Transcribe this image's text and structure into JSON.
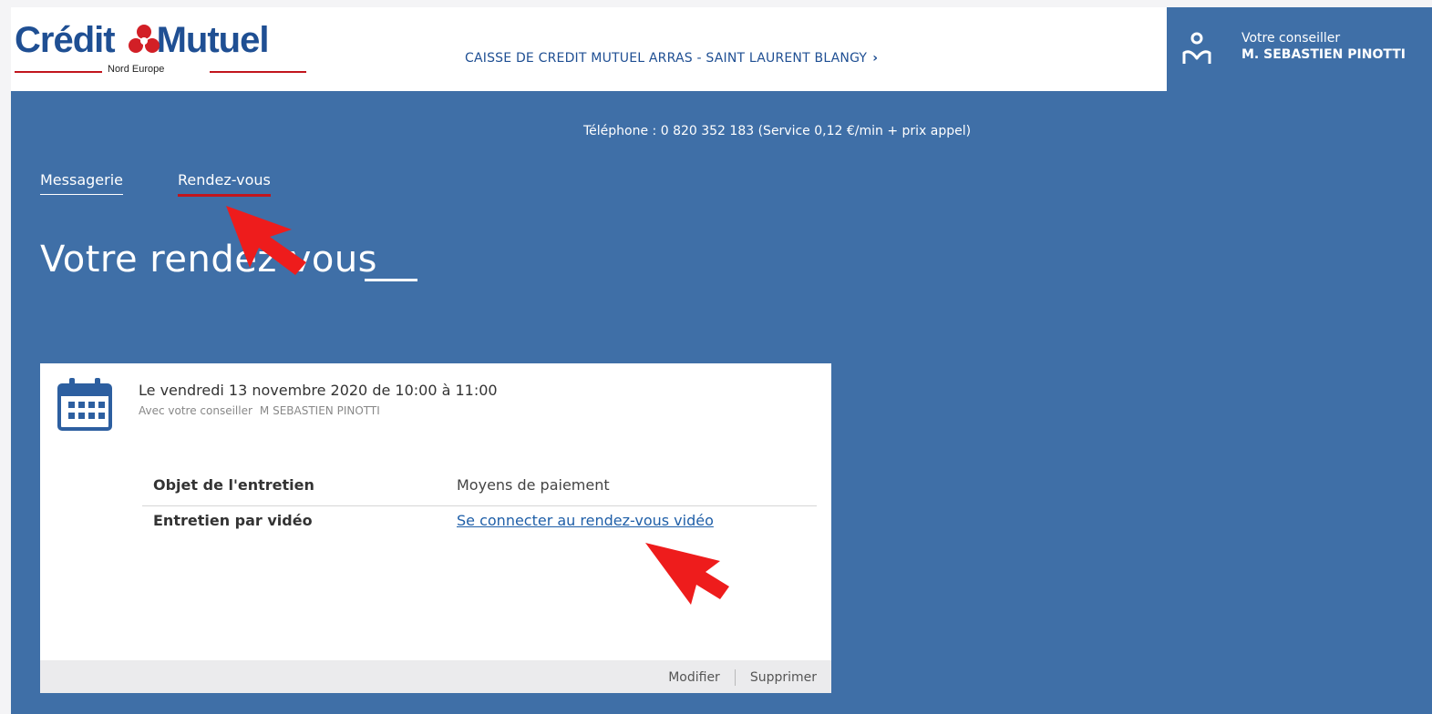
{
  "header": {
    "logo": {
      "brand_part1": "Crédit",
      "brand_part2": "Mutuel",
      "sub": "Nord Europe",
      "emblem_icon": "credit-mutuel-emblem"
    },
    "caisse_link": "CAISSE DE CREDIT MUTUEL ARRAS - SAINT LAURENT BLANGY",
    "caisse_chevron": "›",
    "advisor": {
      "icon": "advisor-person-icon",
      "label": "Votre conseiller",
      "name": "M. SEBASTIEN PINOTTI"
    }
  },
  "phone_line": "Téléphone : 0 820 352 183 (Service 0,12 €/min + prix appel)",
  "tabs": [
    {
      "label": "Messagerie",
      "active": false
    },
    {
      "label": "Rendez-vous",
      "active": true
    }
  ],
  "page_title": "Votre rendez-vous",
  "appointment": {
    "icon": "calendar-icon",
    "date_line": "Le vendredi 13 novembre 2020 de 10:00 à 11:00",
    "with_label": "Avec votre conseiller",
    "with_name": "M SEBASTIEN PINOTTI",
    "rows": [
      {
        "key": "Objet de l'entretien",
        "value": "Moyens de paiement"
      },
      {
        "key": "Entretien par vidéo",
        "value": "Se connecter au rendez-vous vidéo"
      }
    ],
    "actions": {
      "modify": "Modifier",
      "delete": "Supprimer"
    }
  },
  "annotations": {
    "arrow_icon": "red-pointer-arrow",
    "color": "#ee1c1c"
  },
  "colors": {
    "brand_blue": "#1f4f93",
    "background_blue": "#3f6fa7",
    "accent_red": "#c2151d",
    "link_blue": "#1f5fa8"
  }
}
